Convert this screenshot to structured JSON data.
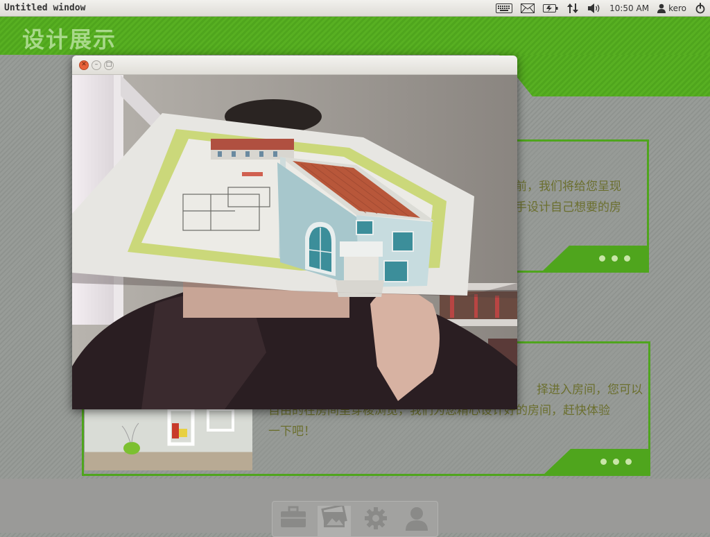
{
  "panel": {
    "window_title": "Untitled window",
    "clock": "10:50 AM",
    "user": "kero",
    "indicators": [
      "keyboard-icon",
      "mail-icon",
      "battery-icon",
      "network-icon",
      "volume-icon"
    ]
  },
  "app": {
    "title": "设计展示"
  },
  "cards": [
    {
      "lines": [
        "前，我们将给您呈现",
        "手设计自己想要的房"
      ]
    },
    {
      "lines": [
        "择进入房间，您可以",
        "自由的在房间里穿梭浏览，我们为您精心设计好的房间，赶快体验",
        "一下吧！"
      ]
    }
  ],
  "dock": {
    "items": [
      "briefcase-icon",
      "gallery-icon",
      "gear-icon",
      "person-icon"
    ],
    "active": "gallery-icon"
  },
  "colors": {
    "accent": "#4fa51d",
    "text": "#6b6f2e",
    "close_button": "#e8623a"
  }
}
